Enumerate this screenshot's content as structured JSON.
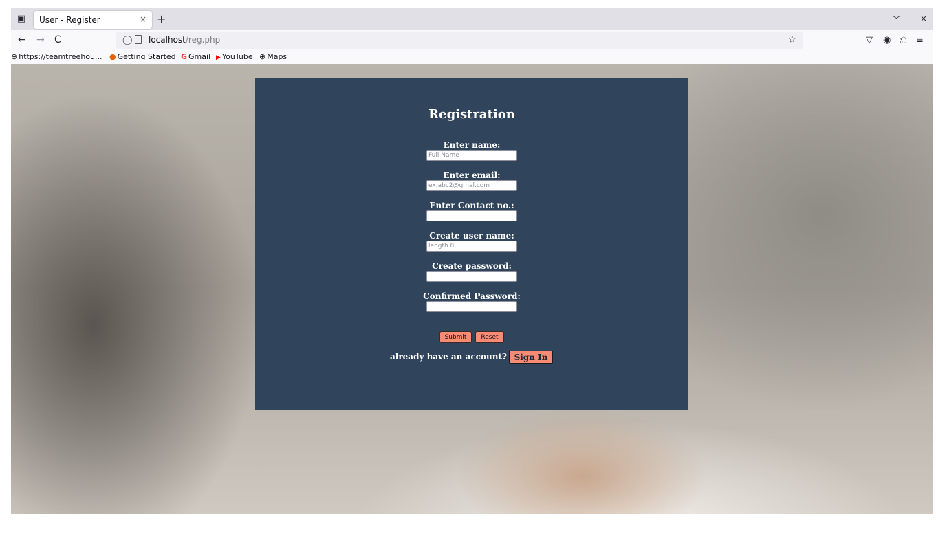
{
  "browser": {
    "tab": {
      "title": "User - Register",
      "close": "×"
    },
    "newtab": "+",
    "tablist": "﹀",
    "window_close": "×",
    "nav": {
      "back": "←",
      "forward": "→",
      "reload": "C"
    },
    "url": {
      "host": "localhost",
      "path": "/reg.php"
    },
    "icons": {
      "star": "☆",
      "pocket": "▽",
      "account": "◉",
      "extensions": "⎌",
      "menu": "≡",
      "shield": "◯",
      "tab_overview": "▣"
    },
    "bookmarks": [
      {
        "icon": "globe-icon",
        "glyph": "⊕",
        "label": "https://teamtreehou..."
      },
      {
        "icon": "firefox-icon",
        "glyph": "●",
        "label": "Getting Started"
      },
      {
        "icon": "google-icon",
        "glyph": "G",
        "label": "Gmail"
      },
      {
        "icon": "youtube-icon",
        "glyph": "▶",
        "label": "YouTube"
      },
      {
        "icon": "globe-icon",
        "glyph": "⊕",
        "label": "Maps"
      }
    ]
  },
  "form": {
    "title": "Registration",
    "fields": [
      {
        "label": "Enter name:",
        "placeholder": "Full Name",
        "value": ""
      },
      {
        "label": "Enter email:",
        "placeholder": "ex.abc2@gmal.com",
        "value": ""
      },
      {
        "label": "Enter Contact no.:",
        "placeholder": "",
        "value": ""
      },
      {
        "label": "Create user name:",
        "placeholder": "length 8",
        "value": ""
      },
      {
        "label": "Create password:",
        "placeholder": "",
        "value": ""
      },
      {
        "label": "Confirmed Password:",
        "placeholder": "",
        "value": ""
      }
    ],
    "submit_label": "Submit",
    "reset_label": "Reset",
    "signin_prompt": "already have an account?",
    "signin_label": "Sign In"
  },
  "colors": {
    "panel": "#30455c",
    "button": "#f98a73",
    "signin_text": "#16293d"
  }
}
